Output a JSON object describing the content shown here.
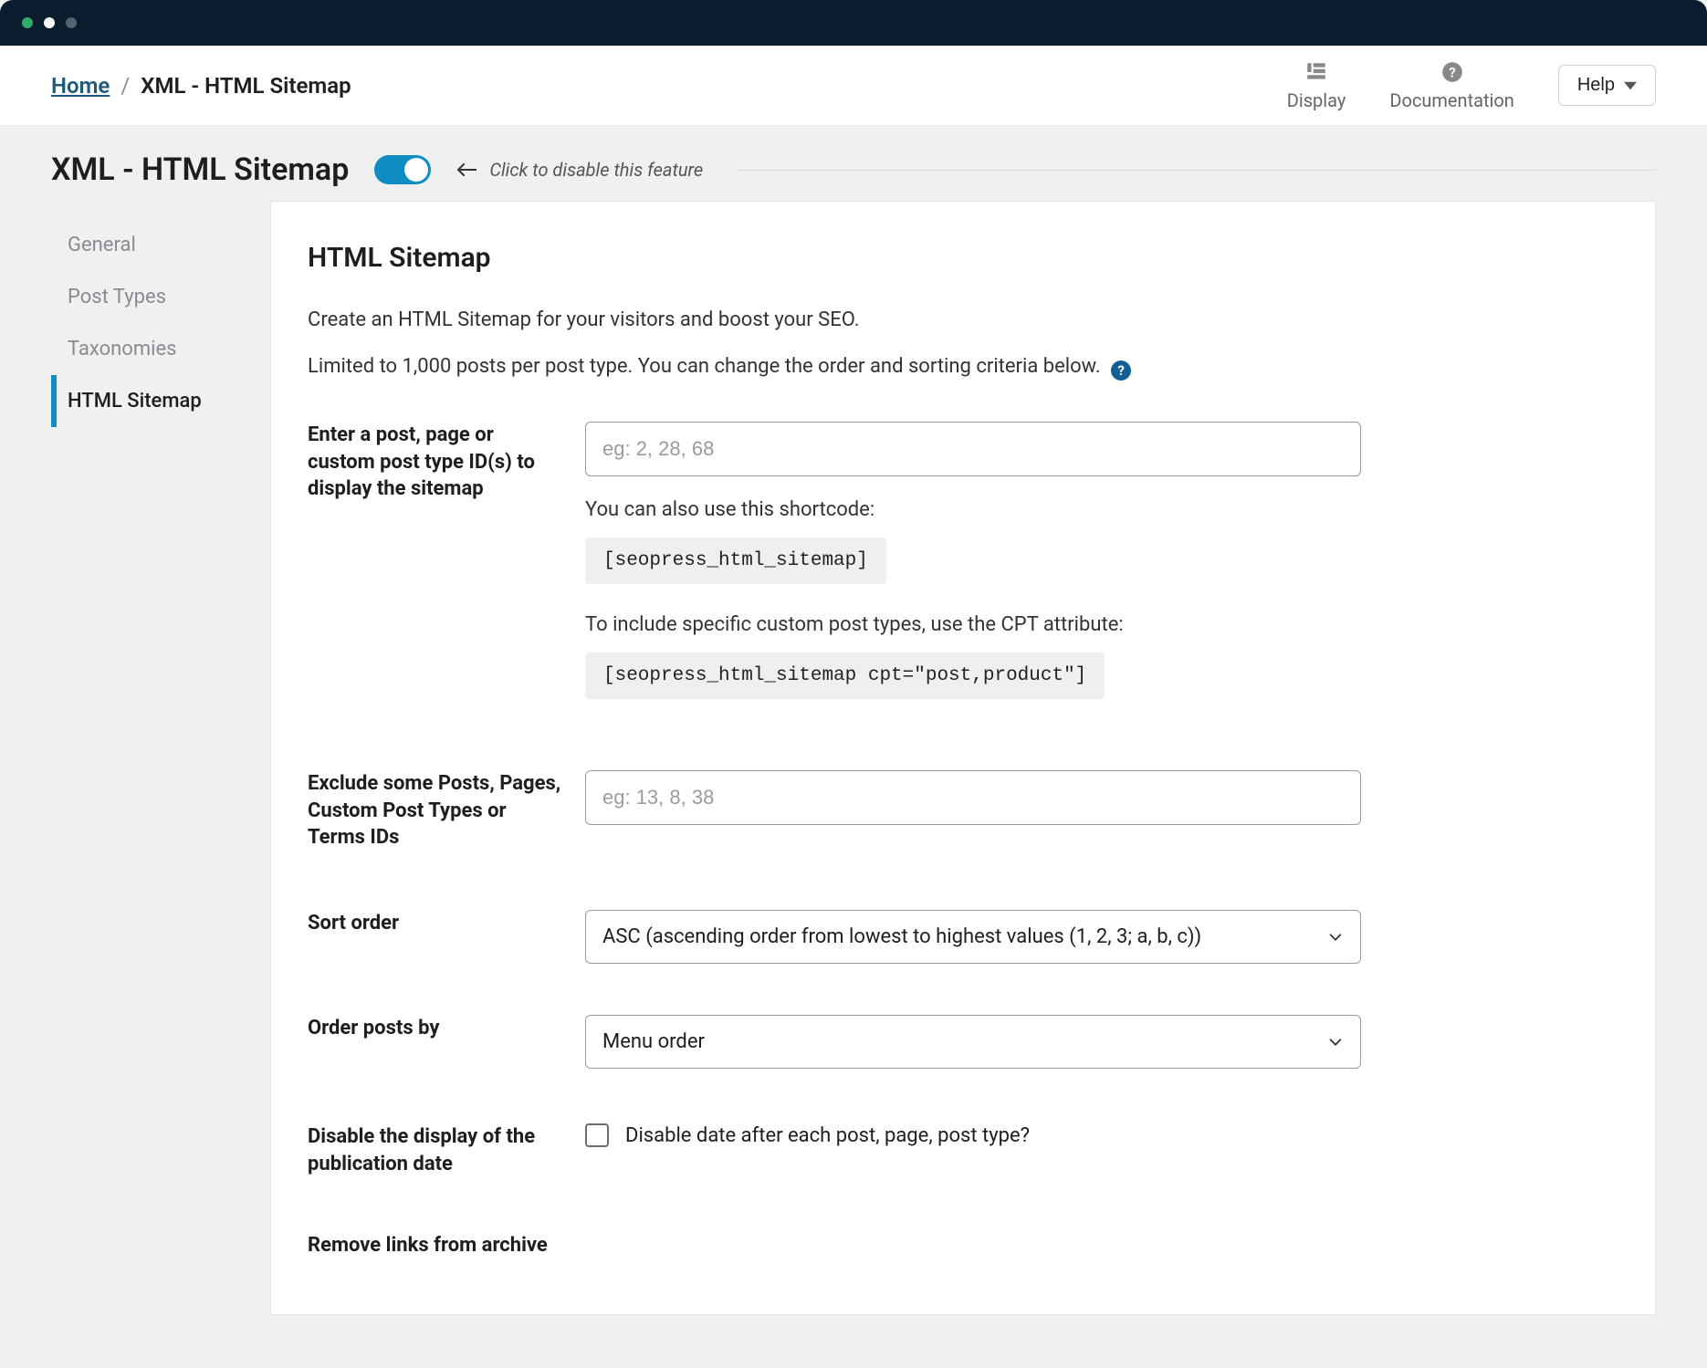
{
  "breadcrumb": {
    "home": "Home",
    "current": "XML - HTML Sitemap"
  },
  "toolbar": {
    "display": "Display",
    "documentation": "Documentation",
    "help": "Help"
  },
  "header": {
    "title": "XML - HTML Sitemap",
    "toggle_hint": "Click to disable this feature"
  },
  "sidebar": {
    "items": [
      {
        "label": "General"
      },
      {
        "label": "Post Types"
      },
      {
        "label": "Taxonomies"
      },
      {
        "label": "HTML Sitemap"
      }
    ]
  },
  "panel": {
    "heading": "HTML Sitemap",
    "desc1": "Create an HTML Sitemap for your visitors and boost your SEO.",
    "desc2": "Limited to 1,000 posts per post type. You can change the order and sorting criteria below.",
    "fields": {
      "ids": {
        "label": "Enter a post, page or custom post type ID(s) to display the sitemap",
        "placeholder": "eg: 2, 28, 68",
        "helper1": "You can also use this shortcode:",
        "code1": "[seopress_html_sitemap]",
        "helper2": "To include specific custom post types, use the CPT attribute:",
        "code2": "[seopress_html_sitemap cpt=\"post,product\"]"
      },
      "exclude": {
        "label": "Exclude some Posts, Pages, Custom Post Types or Terms IDs",
        "placeholder": "eg: 13, 8, 38"
      },
      "sort": {
        "label": "Sort order",
        "value": "ASC (ascending order from lowest to highest values (1, 2, 3; a, b, c))"
      },
      "orderby": {
        "label": "Order posts by",
        "value": "Menu order"
      },
      "disable_date": {
        "label": "Disable the display of the publication date",
        "checkbox_label": "Disable date after each post, page, post type?"
      },
      "remove_links": {
        "label": "Remove links from archive"
      }
    }
  }
}
